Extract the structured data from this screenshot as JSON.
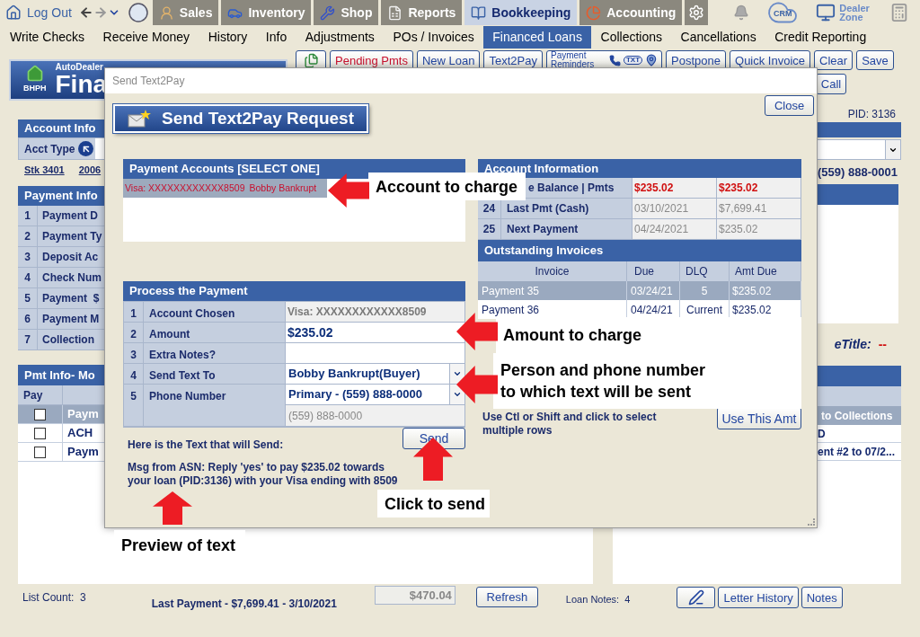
{
  "top_nav": {
    "logout": "Log Out",
    "tabs": [
      {
        "label": "Sales",
        "selected": false
      },
      {
        "label": "Inventory",
        "selected": false
      },
      {
        "label": "Shop",
        "selected": false
      },
      {
        "label": "Reports",
        "selected": false
      },
      {
        "label": "Bookkeeping",
        "selected": true
      },
      {
        "label": "Accounting",
        "selected": false
      }
    ],
    "crm": "CRM",
    "dealer_zone": [
      "Dealer",
      "Zone"
    ]
  },
  "sub_nav": [
    {
      "label": "Write Checks",
      "selected": false
    },
    {
      "label": "Receive Money",
      "selected": false
    },
    {
      "label": "History",
      "selected": false
    },
    {
      "label": "Info",
      "selected": false
    },
    {
      "label": "Adjustments",
      "selected": false
    },
    {
      "label": "POs / Invoices",
      "selected": false
    },
    {
      "label": "Financed Loans",
      "selected": true
    },
    {
      "label": "Collections",
      "selected": false
    },
    {
      "label": "Cancellations",
      "selected": false
    },
    {
      "label": "Credit Reporting",
      "selected": false
    }
  ],
  "banner": {
    "badge": "BHPH",
    "small": "AutoDealer",
    "big": "Fina"
  },
  "toolbar": [
    {
      "label": "Pending Pmts",
      "kind": "alert"
    },
    {
      "label": "New Loan",
      "kind": "plain"
    },
    {
      "label": "Text2Pay",
      "kind": "plain"
    },
    {
      "label": "Payment Reminders",
      "kind": "reminders",
      "badge": "TXT"
    },
    {
      "label": "Postpone",
      "kind": "plain"
    },
    {
      "label": "Quick Invoice",
      "kind": "plain"
    },
    {
      "label": "Clear",
      "kind": "plain"
    },
    {
      "label": "Save",
      "kind": "plain"
    }
  ],
  "call_button": "Call",
  "account_panel": {
    "title": "Account Info",
    "acct_type_label": "Acct Type",
    "stock": [
      "Stk 3401",
      "2006"
    ]
  },
  "payment_panel": {
    "title": "Payment Info",
    "rows": [
      {
        "num": "1",
        "label": "Payment D"
      },
      {
        "num": "2",
        "label": "Payment Ty"
      },
      {
        "num": "3",
        "label": "Deposit Ac"
      },
      {
        "num": "4",
        "label": "Check Num"
      },
      {
        "num": "5",
        "label": "Payment  $"
      },
      {
        "num": "6",
        "label": "Payment M"
      },
      {
        "num": "7",
        "label": "Collection"
      }
    ]
  },
  "pmt_info": {
    "title": "Pmt Info- Mo",
    "pay_header": "Pay",
    "rows": [
      {
        "label": "Paym",
        "checked": false,
        "selected": true
      },
      {
        "label": "ACH",
        "checked": false,
        "selected": false
      },
      {
        "label": "Paym",
        "checked": false,
        "selected": false
      }
    ]
  },
  "right_info": {
    "pid": "PID: 3136",
    "phone": "(559) 888-0001",
    "etitle_label": "eTitle:",
    "etitle_value": "--",
    "collections_header": "to Collections",
    "rows": [
      "D",
      "ent #2 to 07/2..."
    ]
  },
  "footer": {
    "list_count": "List Count:  3",
    "last_payment": "Last Payment - $7,699.41 - 3/10/2021",
    "total": "$470.04",
    "refresh": "Refresh",
    "loan_notes": "Loan Notes:  4",
    "buttons": [
      "Letter History",
      "Notes"
    ]
  },
  "modal": {
    "title": "Send Text2Pay",
    "close": "Close",
    "heading": "Send Text2Pay Request",
    "accounts": {
      "title": "Payment Accounts [SELECT ONE]",
      "items": [
        {
          "card": "Visa: XXXXXXXXXXXX8509",
          "name": "Bobby Bankrupt",
          "selected": true
        }
      ]
    },
    "process": {
      "title": "Process the Payment",
      "rows": [
        {
          "num": "1",
          "label": "Account Chosen",
          "kind": "readonly",
          "value": "Visa: XXXXXXXXXXXX8509"
        },
        {
          "num": "2",
          "label": "Amount",
          "kind": "input",
          "value": "$235.02"
        },
        {
          "num": "3",
          "label": "Extra Notes?",
          "kind": "input"
        },
        {
          "num": "4",
          "label": "Send Text To",
          "kind": "select",
          "value": "Bobby Bankrupt(Buyer)"
        },
        {
          "num": "5",
          "label": "Phone Number",
          "kind": "select",
          "value": "Primary - (559) 888-0000",
          "note": "(559) 888-0000"
        }
      ]
    },
    "preview_label": "Here is the Text that will Send:",
    "send": "Send",
    "message": "Msg from ASN: Reply 'yes' to pay $235.02 towards your loan (PID:3136) with your Visa ending with 8509",
    "account_info": {
      "title": "Account Information",
      "rows": [
        {
          "label": "e Balance | Pmts",
          "values": [
            "$235.02",
            "$235.02"
          ],
          "alert": true
        },
        {
          "num": "24",
          "label": "Last Pmt (Cash)",
          "values": [
            "03/10/2021",
            "$7,699.41"
          ],
          "alert": false
        },
        {
          "num": "25",
          "label": "Next Payment",
          "values": [
            "04/24/2021",
            "$235.02"
          ],
          "alert": false
        }
      ]
    },
    "invoices": {
      "title": "Outstanding Invoices",
      "columns": [
        "Invoice",
        "Due",
        "DLQ",
        "Amt Due"
      ],
      "rows": [
        {
          "cells": [
            "Payment 35",
            "03/24/21",
            "5",
            "$235.02"
          ],
          "selected": true
        },
        {
          "cells": [
            "Payment 36",
            "04/24/21",
            "Current",
            "$235.02"
          ],
          "selected": false
        }
      ]
    },
    "hint": "Use Ctl or Shift and click to select multiple rows",
    "use_amount": "Use This Amt"
  },
  "annotations": [
    {
      "lines": [
        "Account to charge"
      ],
      "kind": "left"
    },
    {
      "lines": [
        "Amount to charge"
      ],
      "kind": "left"
    },
    {
      "lines": [
        "Person and phone number",
        "to which text will be sent"
      ],
      "kind": "left"
    },
    {
      "lines": [
        "Click to send"
      ],
      "kind": "up"
    },
    {
      "lines": [
        "Preview of text"
      ],
      "kind": "up"
    }
  ]
}
